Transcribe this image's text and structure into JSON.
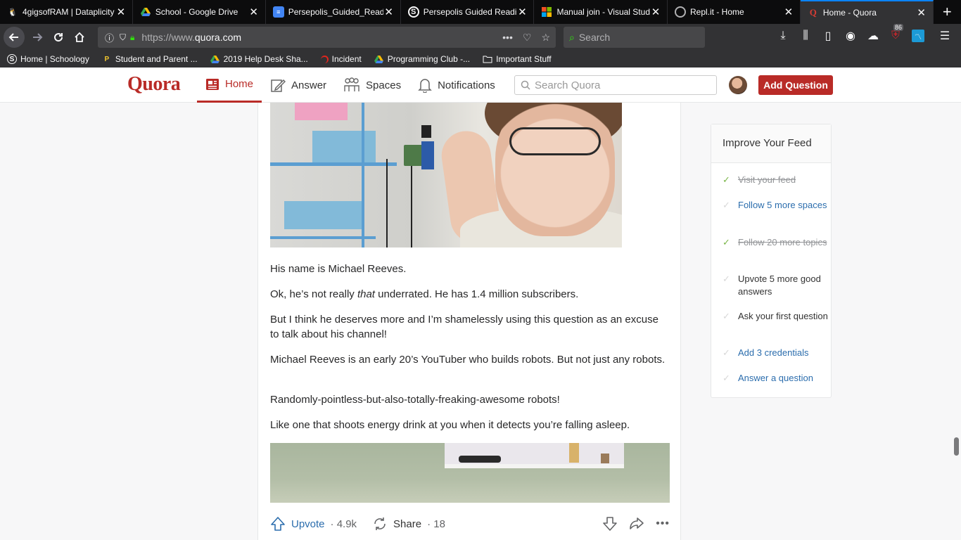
{
  "browser": {
    "tabs": [
      {
        "title": "4gigsofRAM | Dataplicity",
        "icon": "tux-icon"
      },
      {
        "title": "School - Google Drive",
        "icon": "drive-icon"
      },
      {
        "title": "Persepolis_Guided_Readi",
        "icon": "docs-icon"
      },
      {
        "title": "Persepolis Guided Readi",
        "icon": "schoology-icon"
      },
      {
        "title": "Manual join - Visual Stud",
        "icon": "microsoft-icon"
      },
      {
        "title": "Repl.it - Home",
        "icon": "replit-icon"
      },
      {
        "title": "Home - Quora",
        "icon": "quora-icon",
        "active": true
      }
    ],
    "url_prefix": "https://www.",
    "url_domain": "quora.com",
    "search_placeholder": "Search",
    "extension_badge": "86",
    "bookmarks": [
      {
        "label": "Home | Schoology",
        "icon": "schoology-icon"
      },
      {
        "label": "Student and Parent ...",
        "icon": "p-icon"
      },
      {
        "label": "2019 Help Desk Sha...",
        "icon": "drive-icon"
      },
      {
        "label": "Incident",
        "icon": "incident-icon"
      },
      {
        "label": "Programming Club -...",
        "icon": "drive-icon"
      },
      {
        "label": "Important Stuff",
        "icon": "folder-icon"
      }
    ]
  },
  "quora": {
    "logo": "Quora",
    "nav": [
      {
        "label": "Home",
        "icon": "home-feed-icon",
        "active": true
      },
      {
        "label": "Answer",
        "icon": "answer-pencil-icon"
      },
      {
        "label": "Spaces",
        "icon": "spaces-icon"
      },
      {
        "label": "Notifications",
        "icon": "bell-icon"
      }
    ],
    "search_placeholder": "Search Quora",
    "add_question": "Add Question"
  },
  "answer": {
    "p1": "His name is Michael Reeves.",
    "p2_before": "Ok, he’s not really ",
    "p2_em": "that",
    "p2_after": " underrated. He has 1.4 million subscribers.",
    "p3": "But I think he deserves more and I’m shamelessly using this question as an excuse to talk about his channel!",
    "p4": "Michael Reeves is an early 20’s YouTuber who builds robots. But not just any robots.",
    "p5": "Randomly-pointless-but-also-totally-freaking-awesome robots!",
    "p6": "Like one that shoots energy drink at you when it detects you’re falling asleep.",
    "upvote_label": "Upvote",
    "upvote_count": "· 4.9k",
    "share_label": "Share",
    "share_count": "· 18"
  },
  "sidebar": {
    "title": "Improve Your Feed",
    "items": [
      {
        "text": "Visit your feed",
        "state": "done"
      },
      {
        "text": "Follow 5 more spaces",
        "state": "link"
      },
      {
        "text": "Follow 20 more topics",
        "state": "done"
      },
      {
        "text": "Upvote 5 more good answers",
        "state": "plain"
      },
      {
        "text": "Ask your first question",
        "state": "plain"
      },
      {
        "text": "Add 3 credentials",
        "state": "link"
      },
      {
        "text": "Answer a question",
        "state": "link"
      }
    ]
  },
  "colors": {
    "quora_red": "#b92b27",
    "link_blue": "#2b6dad",
    "check_green": "#7ab648",
    "firefox_blue": "#0a84ff"
  }
}
